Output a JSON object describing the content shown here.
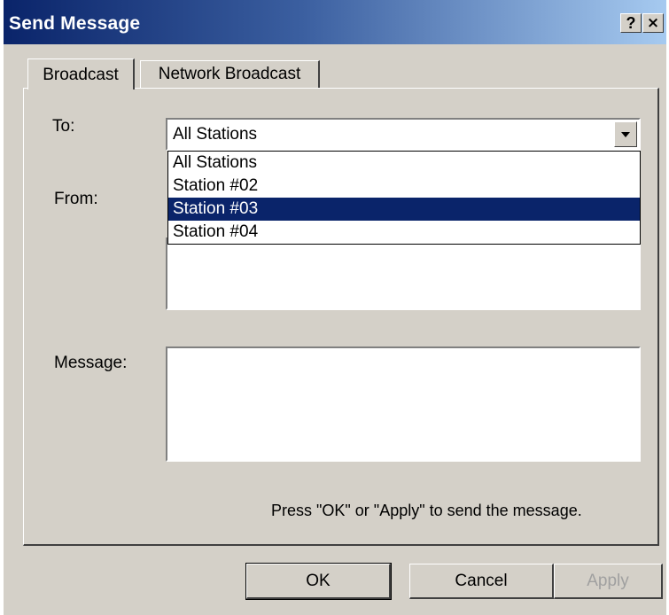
{
  "window": {
    "title": "Send Message",
    "help_label": "?",
    "close_label": "×"
  },
  "tabs": [
    {
      "label": "Broadcast",
      "active": true
    },
    {
      "label": "Network Broadcast",
      "active": false
    }
  ],
  "form": {
    "to_label": "To:",
    "to_value": "All Stations",
    "to_options": [
      "All Stations",
      "Station #02",
      "Station #03",
      "Station #04"
    ],
    "highlighted_option": "Station #03",
    "from_label": "From:",
    "message_label": "Message:",
    "message_value": "",
    "hint": "Press \"OK\" or \"Apply\" to send the message."
  },
  "buttons": {
    "ok": "OK",
    "cancel": "Cancel",
    "apply": "Apply",
    "apply_enabled": false
  },
  "colors": {
    "titlebar_start": "#0a246a",
    "titlebar_end": "#a6caf0",
    "face": "#d4d0c8",
    "selection": "#0a246a"
  }
}
